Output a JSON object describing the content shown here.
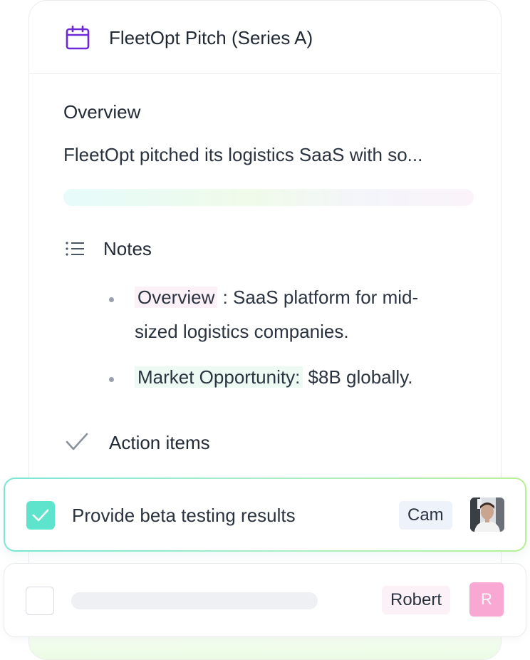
{
  "card": {
    "title": "FleetOpt Pitch (Series A)",
    "title_icon": "calendar-icon",
    "accent_color": "#6d28d9"
  },
  "overview": {
    "heading": "Overview",
    "text": "FleetOpt pitched its logistics SaaS with so..."
  },
  "notes": {
    "heading": "Notes",
    "icon": "list-icon",
    "items": [
      {
        "highlight": "Overview",
        "text": " : SaaS platform for mid-sized logistics companies.",
        "highlight_color": "#fcf1f7"
      },
      {
        "highlight": "Market Opportunity:",
        "text": " $8B globally.",
        "highlight_color": "#ecfaf3"
      }
    ]
  },
  "action_items": {
    "heading": "Action items",
    "icon": "check-icon",
    "items": [
      {
        "text": "Provide beta testing results",
        "checked": true,
        "assignee": "Cam",
        "avatar": "photo"
      },
      {
        "text": "",
        "checked": false,
        "assignee": "Robert",
        "avatar_letter": "R",
        "avatar_color": "#f9a8d4"
      }
    ]
  }
}
